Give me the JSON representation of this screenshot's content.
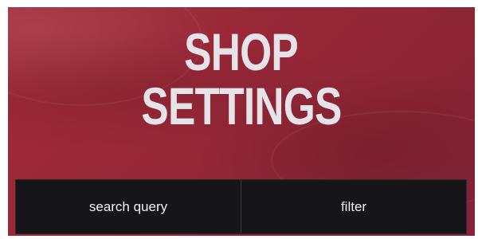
{
  "header": {
    "title_line1": "SHOP",
    "title_line2": "SETTINGS"
  },
  "actions": {
    "search_label": "search query",
    "filter_label": "filter"
  },
  "colors": {
    "background": "#962737",
    "title_text": "#e6e3e8",
    "bar_background": "#161618",
    "bar_text": "#f2f2f2"
  }
}
